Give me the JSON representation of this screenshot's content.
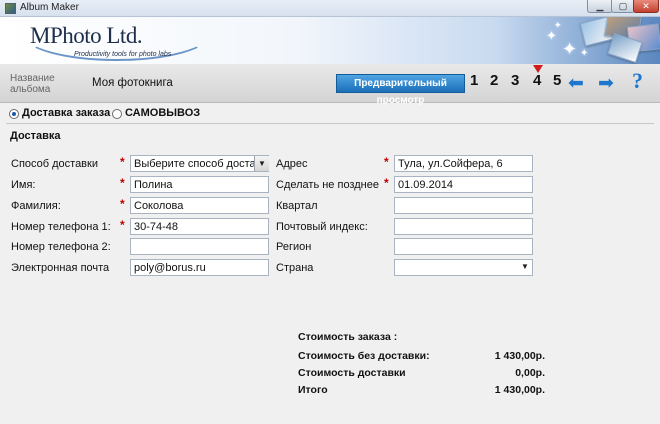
{
  "window": {
    "title": "Album Maker"
  },
  "banner": {
    "logo": "MPhoto Ltd.",
    "tagline": "Productivity tools for photo labs"
  },
  "nav": {
    "album_label": "Название альбома",
    "album_name": "Моя фотокнига",
    "preview_button": "Предварительный просмотр",
    "steps": [
      "1",
      "2",
      "3",
      "4",
      "5"
    ],
    "current_step": "4",
    "prev_icon": "arrow-left-icon",
    "next_icon": "arrow-right-icon",
    "help": "?"
  },
  "delivery_mode": {
    "options": [
      {
        "label": "Доставка заказа",
        "selected": true
      },
      {
        "label": "САМОВЫВОЗ",
        "selected": false
      }
    ]
  },
  "section_title": "Доставка",
  "left_fields": [
    {
      "label": "Способ доставки",
      "value": "Выберите способ доставки",
      "required": true,
      "type": "select"
    },
    {
      "label": "Имя:",
      "value": "Полина",
      "required": true,
      "type": "text"
    },
    {
      "label": "Фамилия:",
      "value": "Соколова",
      "required": true,
      "type": "text"
    },
    {
      "label": "Номер телефона 1:",
      "value": "30-74-48",
      "required": true,
      "type": "text"
    },
    {
      "label": "Номер телефона 2:",
      "value": "",
      "required": false,
      "type": "text"
    },
    {
      "label": "Электронная почта",
      "value": "poly@borus.ru",
      "required": false,
      "type": "text"
    }
  ],
  "right_fields": [
    {
      "label": "Адрес",
      "value": "Тула, ул.Сойфера, 6",
      "required": true,
      "type": "text"
    },
    {
      "label": "Сделать не позднее",
      "value": "01.09.2014",
      "required": true,
      "type": "text"
    },
    {
      "label": "Квартал",
      "value": "",
      "required": false,
      "type": "text"
    },
    {
      "label": "Почтовый индекс:",
      "value": "",
      "required": false,
      "type": "text"
    },
    {
      "label": "Регион",
      "value": "",
      "required": false,
      "type": "text"
    },
    {
      "label": "Страна",
      "value": "",
      "required": false,
      "type": "select"
    }
  ],
  "totals": {
    "heading": "Стоимость заказа :",
    "rows": [
      {
        "label": "Стоимость без доставки:",
        "value": "1 430,00р."
      },
      {
        "label": "Стоимость доставки",
        "value": "0,00р."
      },
      {
        "label": "Итого",
        "value": "1 430,00р."
      }
    ]
  },
  "required_mark": "*",
  "colors": {
    "accent": "#1e77cc",
    "required": "#c00000",
    "preview_button": "#2a86cf"
  }
}
